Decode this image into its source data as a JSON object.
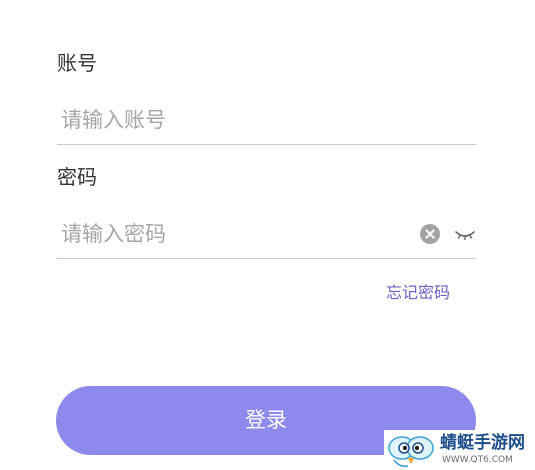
{
  "account": {
    "label": "账号",
    "placeholder": "请输入账号",
    "value": ""
  },
  "password": {
    "label": "密码",
    "placeholder": "请输入密码",
    "value": ""
  },
  "forgot_password": "忘记密码",
  "login_button": "登录",
  "watermark": {
    "title": "蜻蜓手游网",
    "url": "WWW.QT6.COM"
  },
  "colors": {
    "accent": "#8e89ec",
    "link": "#6a5fc7",
    "divider": "#c8c8c8",
    "placeholder": "#a6a6a6"
  },
  "icons": {
    "clear": "clear-circle-icon",
    "visibility": "eye-closed-icon"
  }
}
